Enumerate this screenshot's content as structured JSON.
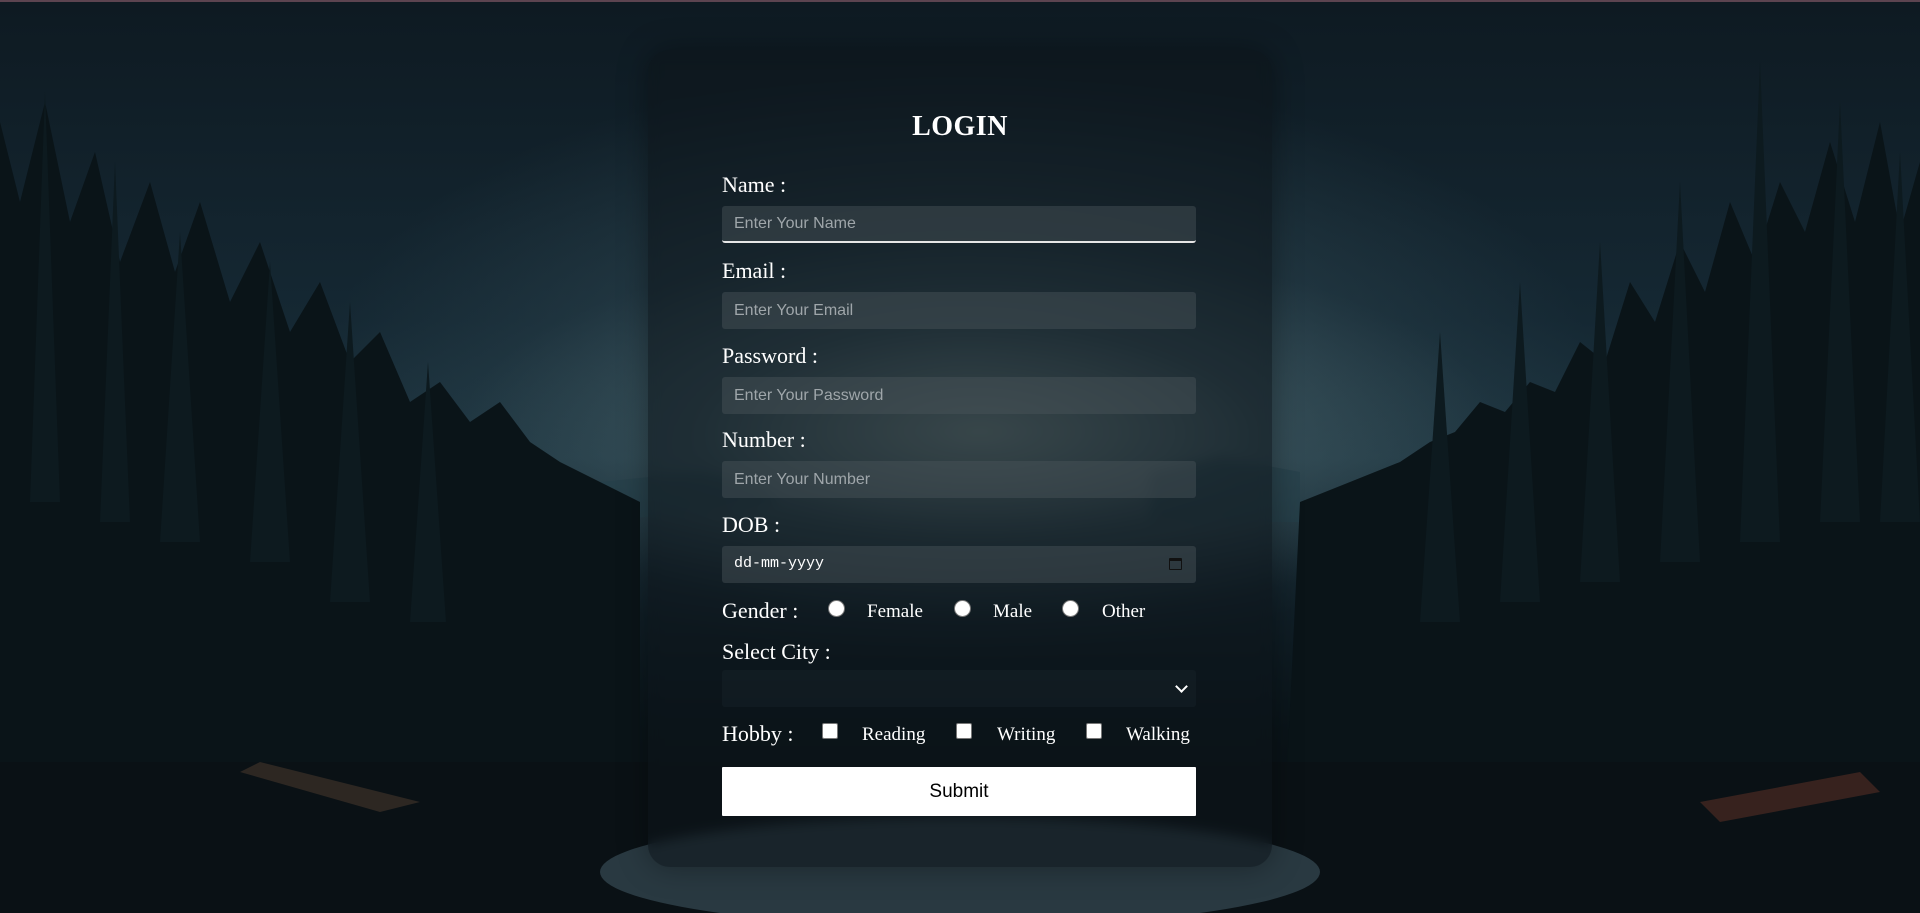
{
  "form": {
    "title": "LOGIN",
    "name": {
      "label": "Name :",
      "placeholder": "Enter Your Name"
    },
    "email": {
      "label": "Email :",
      "placeholder": "Enter Your Email"
    },
    "password": {
      "label": "Password :",
      "placeholder": "Enter Your Password"
    },
    "number": {
      "label": "Number :",
      "placeholder": "Enter Your Number"
    },
    "dob": {
      "label": "DOB :",
      "value": "dd-mm-yyyy"
    },
    "gender": {
      "label": "Gender :",
      "options": [
        "Female",
        "Male",
        "Other"
      ]
    },
    "city": {
      "label": "Select City :",
      "value": ""
    },
    "hobby": {
      "label": "Hobby :",
      "options": [
        "Reading",
        "Writing",
        "Walking"
      ]
    },
    "submit_label": "Submit"
  },
  "colors": {
    "card_background": "#0c141a",
    "text": "#ffffff",
    "submit_background": "#ffffff"
  },
  "icons": [
    "calendar-icon",
    "chevron-down-icon"
  ]
}
